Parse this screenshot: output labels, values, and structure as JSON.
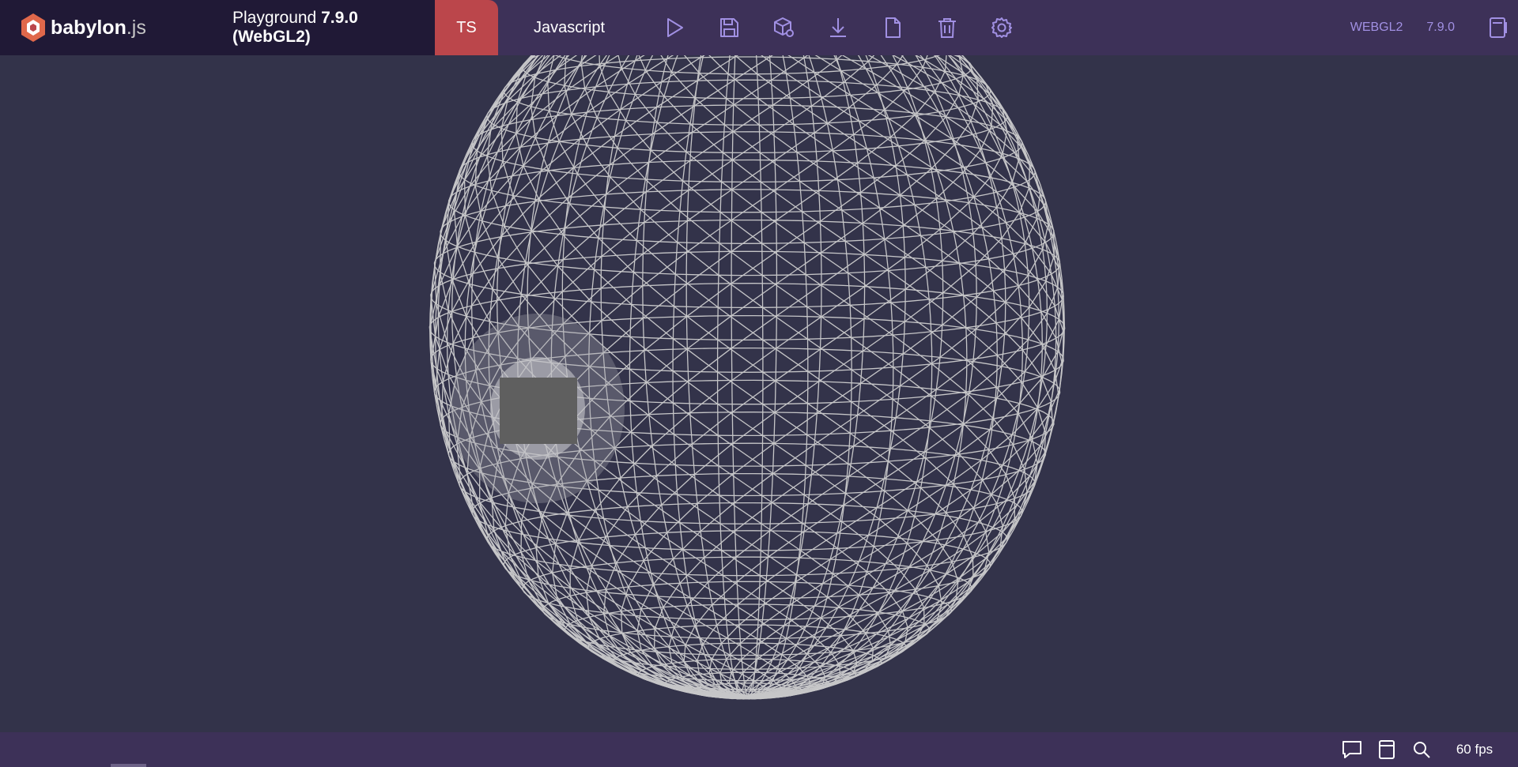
{
  "brand": {
    "name_main": "babylon",
    "name_ext": ".js"
  },
  "header": {
    "title_prefix": "Playground ",
    "title_version": "7.9.0 (WebGL2)"
  },
  "tabs": [
    {
      "label": "TS",
      "active": true
    },
    {
      "label": "Javascript",
      "active": false
    }
  ],
  "toolbar": [
    {
      "icon": "play-icon"
    },
    {
      "icon": "save-icon"
    },
    {
      "icon": "inspector-cube-icon"
    },
    {
      "icon": "download-icon"
    },
    {
      "icon": "new-file-icon"
    },
    {
      "icon": "delete-icon"
    },
    {
      "icon": "settings-gear-icon"
    }
  ],
  "right_info": {
    "engine": "WEBGL2",
    "version": "7.9.0"
  },
  "footer": {
    "fps": "60 fps"
  },
  "colors": {
    "topbar": "#3d3158",
    "brand_bg": "#201936",
    "ts_tab": "#bb464b",
    "accent": "#a190e3",
    "scene_bg": "#33334a",
    "wireframe": "#d6d6d6"
  },
  "scene": {
    "description": "wireframe sphere",
    "mesh": "icosphere",
    "inner_box": "gray cube"
  }
}
